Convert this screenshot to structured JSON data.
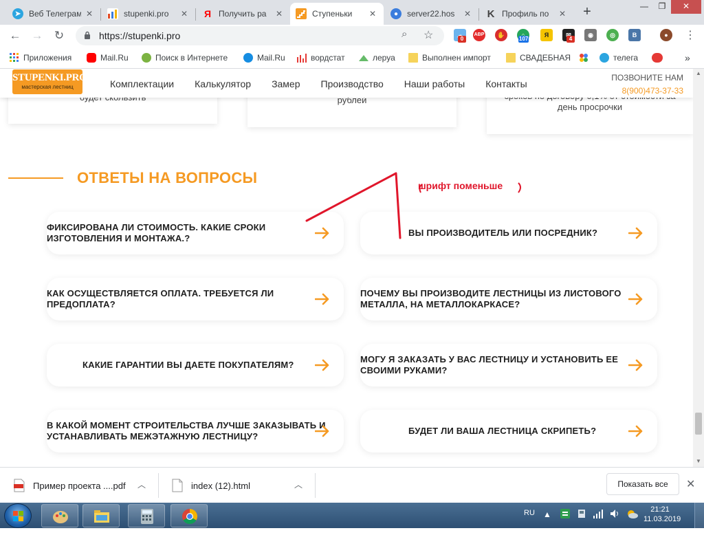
{
  "browser": {
    "tabs": [
      {
        "title": "Веб Телеграм",
        "favicon_color": "#2ca5e0",
        "favicon": "telegram-icon",
        "active": false
      },
      {
        "title": "stupenki.pro",
        "favicon_color": "#e34c26",
        "favicon": "chart-icon",
        "active": false
      },
      {
        "title": "Получить ра",
        "favicon_color": "#ff0000",
        "favicon": "yandex-icon",
        "active": false
      },
      {
        "title": "Ступеньки",
        "favicon_color": "#f59a23",
        "favicon": "stupenki-icon",
        "active": true
      },
      {
        "title": "server22.hos",
        "favicon_color": "#3b7ddd",
        "favicon": "server-icon",
        "active": false
      },
      {
        "title": "Профиль по",
        "favicon_color": "#444444",
        "favicon": "k-icon",
        "active": false
      }
    ],
    "url": "https://stupenki.pro",
    "new_tab": "+",
    "extensions": [
      {
        "name": "weather-icon",
        "color": "#6cb4ee",
        "badge": "0",
        "badge_color": "#d93025"
      },
      {
        "name": "adblock-icon",
        "color": "#e32b2b",
        "text": "ABP",
        "badge": "",
        "badge_color": ""
      },
      {
        "name": "stop-icon",
        "color": "#d92d2d",
        "text": "",
        "badge": "",
        "badge_color": ""
      },
      {
        "name": "counter-icon",
        "color": "#26a65b",
        "badge": "107",
        "badge_color": "#1a73e8"
      },
      {
        "name": "yandex-bar-icon",
        "color": "#f5c400",
        "text": "",
        "badge": "",
        "badge_color": ""
      },
      {
        "name": "mail-ext-icon",
        "color": "#222222",
        "badge": "4",
        "badge_color": "#d93025"
      },
      {
        "name": "camera-icon",
        "color": "#777777",
        "text": "",
        "badge": "",
        "badge_color": ""
      },
      {
        "name": "screenshot-icon",
        "color": "#4caf50",
        "text": "",
        "badge": "",
        "badge_color": ""
      },
      {
        "name": "vk-icon",
        "color": "#4a76a8",
        "text": "В",
        "badge": "",
        "badge_color": ""
      },
      {
        "name": "profile-avatar-icon",
        "color": "#8b4a2b",
        "text": "",
        "badge": "",
        "badge_color": ""
      }
    ],
    "bookmarks": [
      {
        "label": "Приложения",
        "icon": "apps-grid-icon",
        "color": "#4285f4"
      },
      {
        "label": "Mail.Ru",
        "icon": "youtube-icon",
        "color": "#ff0000"
      },
      {
        "label": "Поиск в Интернете",
        "icon": "ke-icon",
        "color": "#7cb342"
      },
      {
        "label": "Mail.Ru",
        "icon": "mailru-icon",
        "color": "#168de2"
      },
      {
        "label": "вордстат",
        "icon": "wordstat-icon",
        "color": "#e53935"
      },
      {
        "label": "леруа",
        "icon": "leroy-icon",
        "color": "#66bb6a"
      },
      {
        "label": "Выполнен импорт",
        "icon": "folder-icon",
        "color": "#f6d35b"
      },
      {
        "label": "СВАДЕБНАЯ",
        "icon": "folder-icon",
        "color": "#f6d35b"
      },
      {
        "label": "",
        "icon": "colorful-dots-icon",
        "color": "#ea4335"
      },
      {
        "label": "телега",
        "icon": "telegram-icon",
        "color": "#2ca5e0"
      },
      {
        "label": "",
        "icon": "red-oval-icon",
        "color": "#e53935"
      }
    ],
    "more_bookmarks": "»"
  },
  "site": {
    "logo_top": "STUPENKI.PRO",
    "logo_bottom": "мастерская лестниц",
    "menu": [
      "Комплектации",
      "Калькулятор",
      "Замер",
      "Производство",
      "Наши работы",
      "Контакты"
    ],
    "call_label": "ПОЗВОНИТЕ НАМ",
    "phone": "8(900)473-37-33",
    "top_cards": [
      {
        "text": "будет скользить"
      },
      {
        "text": "рублей"
      },
      {
        "text": "сроков по договору 0,1% от стоимости за день просрочки"
      }
    ],
    "section_title": "ОТВЕТЫ НА ВОПРОСЫ",
    "faq": [
      {
        "q": "ФИКСИРОВАНА ЛИ СТОИМОСТЬ. КАКИЕ СРОКИ ИЗГОТОВЛЕНИЯ И МОНТАЖА.?"
      },
      {
        "q": "ВЫ ПРОИЗВОДИТЕЛЬ ИЛИ ПОСРЕДНИК?"
      },
      {
        "q": "КАК ОСУЩЕСТВЛЯЕТСЯ ОПЛАТА. ТРЕБУЕТСЯ ЛИ ПРЕДОПЛАТА?"
      },
      {
        "q": "ПОЧЕМУ ВЫ ПРОИЗВОДИТЕ ЛЕСТНИЦЫ ИЗ ЛИСТОВОГО МЕТАЛЛА, НА МЕТАЛЛОКАРКАСЕ?"
      },
      {
        "q": "КАКИЕ ГАРАНТИИ ВЫ ДАЕТЕ ПОКУПАТЕЛЯМ?"
      },
      {
        "q": "МОГУ Я ЗАКАЗАТЬ У ВАС ЛЕСТНИЦУ И УСТАНОВИТЬ ЕЕ СВОИМИ РУКАМИ?"
      },
      {
        "q": "В КАКОЙ МОМЕНТ СТРОИТЕЛЬСТВА ЛУЧШЕ ЗАКАЗЫВАТЬ И УСТАНАВЛИВАТЬ МЕЖЭТАЖНУЮ ЛЕСТНИЦУ?"
      },
      {
        "q": "БУДЕТ ЛИ ВАША ЛЕСТНИЦА СКРИПЕТЬ?"
      }
    ],
    "annotation": "шрифт поменьше",
    "accent_color": "#f59a23",
    "annotation_color": "#e0162b"
  },
  "downloads": {
    "items": [
      {
        "name": "Пример проекта ....pdf",
        "icon": "pdf-file-icon"
      },
      {
        "name": "index (12).html",
        "icon": "html-file-icon"
      }
    ],
    "show_all": "Показать все",
    "close": "✕"
  },
  "taskbar": {
    "lang": "RU",
    "time": "21:21",
    "date": "11.03.2019",
    "apps": [
      "paint-icon",
      "explorer-icon",
      "calculator-icon",
      "chrome-icon"
    ]
  }
}
